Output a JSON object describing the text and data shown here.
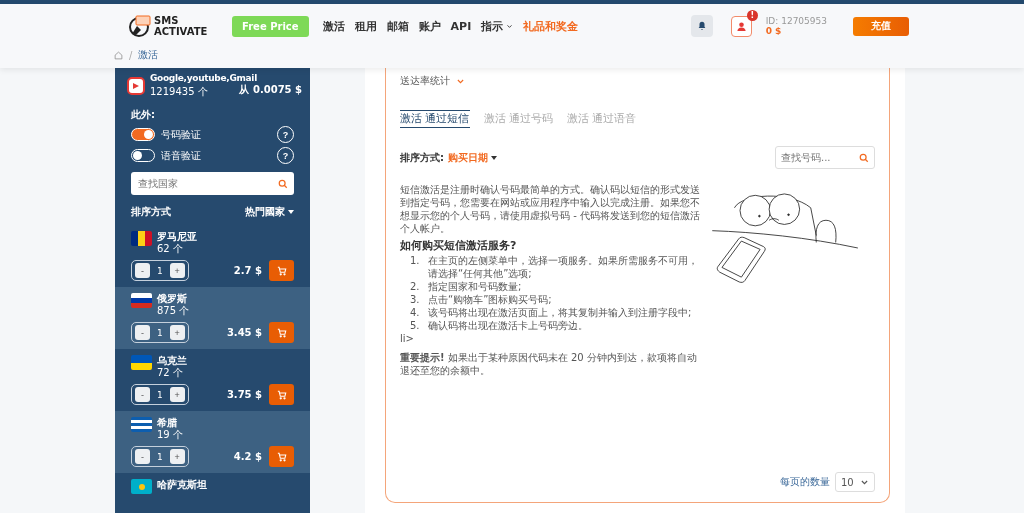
{
  "header": {
    "logo_top": "SMS",
    "logo_bottom": "ACTIVATE",
    "free_price": "Free Price",
    "nav": [
      {
        "label": "激活",
        "kind": "plain"
      },
      {
        "label": "租用",
        "kind": "plain"
      },
      {
        "label": "邮箱",
        "kind": "plain"
      },
      {
        "label": "账户",
        "kind": "plain"
      },
      {
        "label": "API",
        "kind": "plain"
      },
      {
        "label": "指示",
        "kind": "dropdown"
      },
      {
        "label": "礼品和奖金",
        "kind": "accent"
      }
    ],
    "notification_count": "!",
    "user_id": "ID: 12705953",
    "balance": "0 $",
    "topup": "充值"
  },
  "breadcrumbs": {
    "separator": "/",
    "current": "激活"
  },
  "sidebar": {
    "service": {
      "name": "Google,youtube,Gmail",
      "count": "1219435 个",
      "price": "从 0.0075 $"
    },
    "extra_label": "此外:",
    "toggles": [
      {
        "label": "号码验证",
        "on": true,
        "help": "?"
      },
      {
        "label": "语音验证",
        "on": false,
        "help": "?"
      }
    ],
    "search": {
      "placeholder": "查找国家"
    },
    "sort_label": "排序方式",
    "sort_value": "热門國家",
    "countries": [
      {
        "kind": "romania",
        "name": "罗马尼亚",
        "count": "62 个",
        "qty": "1",
        "minus": "-",
        "plus": "+",
        "price": "2.7 $",
        "selected": false
      },
      {
        "kind": "russia",
        "name": "俄罗斯",
        "count": "875 个",
        "qty": "1",
        "minus": "-",
        "plus": "+",
        "price": "3.45 $",
        "selected": true
      },
      {
        "kind": "ukraine",
        "name": "乌克兰",
        "count": "72 个",
        "qty": "1",
        "minus": "-",
        "plus": "+",
        "price": "3.75 $",
        "selected": false
      },
      {
        "kind": "greece",
        "name": "希腊",
        "count": "19 个",
        "qty": "1",
        "minus": "-",
        "plus": "+",
        "price": "4.2 $",
        "selected": true
      },
      {
        "kind": "kazakhstan",
        "name": "哈萨克斯坦",
        "selected": false
      }
    ]
  },
  "main": {
    "stats_label": "送达率统计",
    "tabs": [
      {
        "label": "激活 通过短信",
        "selected": true
      },
      {
        "label": "激活 通过号码",
        "selected": false
      },
      {
        "label": "激活 通过语音",
        "selected": false
      }
    ],
    "sort_label": "排序方式:",
    "sort_value": "购买日期",
    "search": {
      "placeholder": "查找号码..."
    },
    "intro": "短信激活是注册时确认号码最简单的方式。确认码以短信的形式发送到指定号码，您需要在网站或应用程序中输入以完成注册。如果您不想显示您的个人号码，请使用虚拟号码 - 代码将发送到您的短信激活个人帐户。",
    "howto_title": "如何购买短信激活服务?",
    "steps": [
      "在主页的左侧菜单中，选择一项服务。如果所需服务不可用，请选择“任何其他”选项;",
      "指定国家和号码数量;",
      "点击“购物车”图标购买号码;",
      "该号码将出现在激活页面上，将其复制并输入到注册字段中;",
      "确认码将出现在激活卡上号码旁边。"
    ],
    "step_numbers": [
      "1.",
      "2.",
      "3.",
      "4.",
      "5."
    ],
    "stray": "li>",
    "note": "**重要提示!** 如果出于某种原因代码未在 20 分钟内到达，款项将自动退还至您的余额中。",
    "per_page_label": "每页的数量",
    "per_page_value": "10"
  }
}
